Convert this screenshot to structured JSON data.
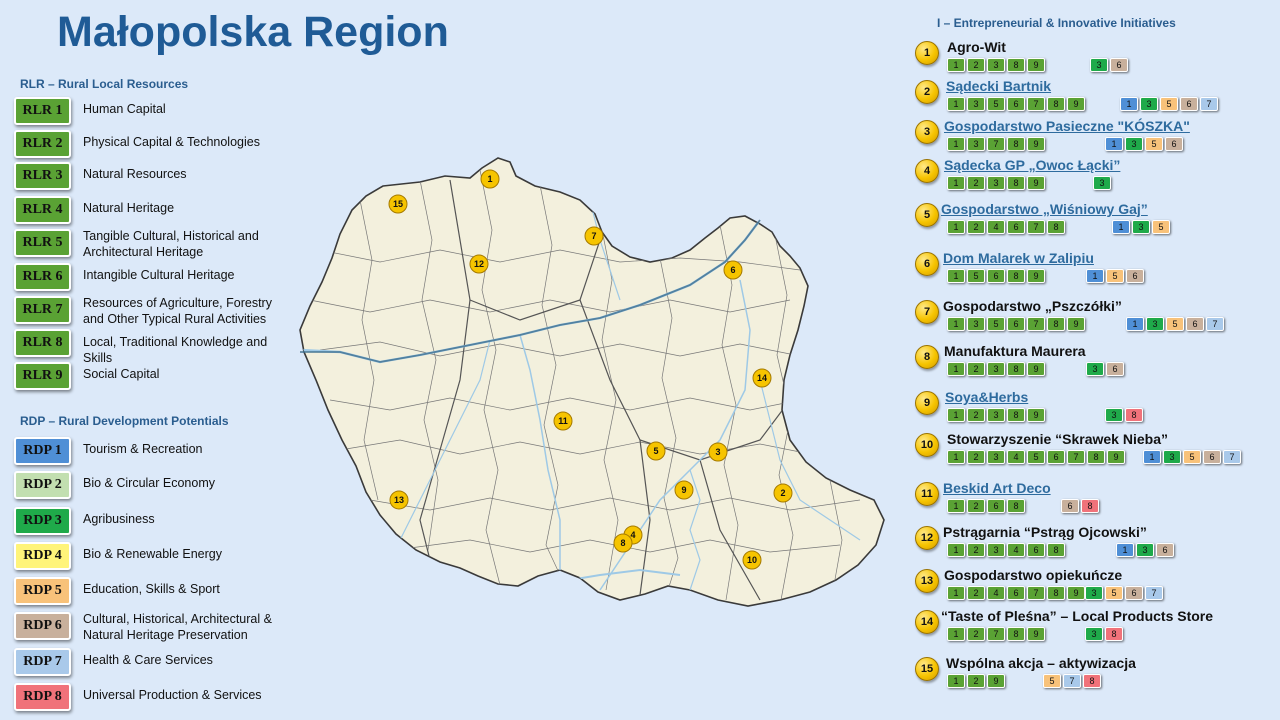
{
  "title": "Małopolska Region",
  "colors": {
    "rlr": "#5aa234",
    "rdp": [
      "#4f8fd6",
      "#c2dfb0",
      "#1faa4a",
      "#fff47a",
      "#f8c27a",
      "#c8b09c",
      "#a9c9ea",
      "#f0727a"
    ],
    "map_fill": "#f3f0dd",
    "river": "#9ec9e6",
    "pin": "#f6c400"
  },
  "rlr": {
    "heading": "RLR – Rural Local Resources",
    "items": [
      {
        "code": "RLR 1",
        "label": "Human Capital"
      },
      {
        "code": "RLR 2",
        "label": "Physical Capital & Technologies"
      },
      {
        "code": "RLR 3",
        "label": "Natural Resources"
      },
      {
        "code": "RLR 4",
        "label": "Natural Heritage"
      },
      {
        "code": "RLR 5",
        "label": "Tangible Cultural, Historical and Architectural Heritage"
      },
      {
        "code": "RLR 6",
        "label": "Intangible Cultural Heritage"
      },
      {
        "code": "RLR 7",
        "label": "Resources of Agriculture, Forestry and Other Typical Rural Activities"
      },
      {
        "code": "RLR 8",
        "label": "Local, Traditional Knowledge and Skills"
      },
      {
        "code": "RLR 9",
        "label": "Social Capital"
      }
    ]
  },
  "rdp": {
    "heading": "RDP – Rural Development Potentials",
    "items": [
      {
        "code": "RDP 1",
        "label": "Tourism & Recreation"
      },
      {
        "code": "RDP 2",
        "label": "Bio & Circular Economy"
      },
      {
        "code": "RDP 3",
        "label": "Agribusiness"
      },
      {
        "code": "RDP 4",
        "label": "Bio & Renewable Energy"
      },
      {
        "code": "RDP 5",
        "label": "Education, Skills & Sport"
      },
      {
        "code": "RDP 6",
        "label": "Cultural, Historical, Architectural & Natural Heritage Preservation"
      },
      {
        "code": "RDP 7",
        "label": "Health & Care Services"
      },
      {
        "code": "RDP 8",
        "label": "Universal Production & Services"
      }
    ]
  },
  "initiatives": {
    "heading": "I – Entrepreneurial & Innovative Initiatives",
    "items": [
      {
        "num": "1",
        "name": "Agro-Wit",
        "link": false,
        "rlr": [
          "1",
          "2",
          "3",
          "8",
          "9"
        ],
        "rdp": [
          "3",
          "6"
        ]
      },
      {
        "num": "2",
        "name": "Sądecki Bartnik",
        "link": true,
        "rlr": [
          "1",
          "3",
          "5",
          "6",
          "7",
          "8",
          "9"
        ],
        "rdp": [
          "1",
          "3",
          "5",
          "6",
          "7"
        ]
      },
      {
        "num": "3",
        "name": "Gospodarstwo Pasieczne \"KÓSZKA\"",
        "link": true,
        "rlr": [
          "1",
          "3",
          "7",
          "8",
          "9"
        ],
        "rdp": [
          "1",
          "3",
          "5",
          "6"
        ]
      },
      {
        "num": "4",
        "name": "Sądecka GP „Owoc Łącki”",
        "link": true,
        "rlr": [
          "1",
          "2",
          "3",
          "8",
          "9"
        ],
        "rdp": [
          "3"
        ]
      },
      {
        "num": "5",
        "name": "Gospodarstwo „Wiśniowy Gaj”",
        "link": true,
        "rlr": [
          "1",
          "2",
          "4",
          "6",
          "7",
          "8"
        ],
        "rdp": [
          "1",
          "3",
          "5"
        ]
      },
      {
        "num": "6",
        "name": "Dom Malarek w Zalipiu",
        "link": true,
        "rlr": [
          "1",
          "5",
          "6",
          "8",
          "9"
        ],
        "rdp": [
          "1",
          "5",
          "6"
        ]
      },
      {
        "num": "7",
        "name": "Gospodarstwo „Pszczółki”",
        "link": false,
        "rlr": [
          "1",
          "3",
          "5",
          "6",
          "7",
          "8",
          "9"
        ],
        "rdp": [
          "1",
          "3",
          "5",
          "6",
          "7"
        ]
      },
      {
        "num": "8",
        "name": "Manufaktura Maurera",
        "link": false,
        "rlr": [
          "1",
          "2",
          "3",
          "8",
          "9"
        ],
        "rdp": [
          "3",
          "6"
        ]
      },
      {
        "num": "9",
        "name": "Soya&Herbs",
        "link": true,
        "rlr": [
          "1",
          "2",
          "3",
          "8",
          "9"
        ],
        "rdp": [
          "3",
          "8"
        ]
      },
      {
        "num": "10",
        "name": "Stowarzyszenie “Skrawek Nieba”",
        "link": false,
        "rlr": [
          "1",
          "2",
          "3",
          "4",
          "5",
          "6",
          "7",
          "8",
          "9"
        ],
        "rdp": [
          "1",
          "3",
          "5",
          "6",
          "7"
        ]
      },
      {
        "num": "11",
        "name": "Beskid Art Deco",
        "link": true,
        "rlr": [
          "1",
          "2",
          "6",
          "8"
        ],
        "rdp": [
          "6",
          "8"
        ]
      },
      {
        "num": "12",
        "name": "Pstrągarnia “Pstrąg Ojcowski”",
        "link": false,
        "rlr": [
          "1",
          "2",
          "3",
          "4",
          "6",
          "8"
        ],
        "rdp": [
          "1",
          "3",
          "6"
        ]
      },
      {
        "num": "13",
        "name": "Gospodarstwo opiekuńcze",
        "link": false,
        "rlr": [
          "1",
          "2",
          "4",
          "6",
          "7",
          "8",
          "9"
        ],
        "rdp": [
          "3",
          "5",
          "6",
          "7"
        ]
      },
      {
        "num": "14",
        "name": "“Taste of Pleśna” – Local Products Store",
        "link": false,
        "rlr": [
          "1",
          "2",
          "7",
          "8",
          "9"
        ],
        "rdp": [
          "3",
          "8"
        ]
      },
      {
        "num": "15",
        "name": "Wspólna akcja – aktywizacja",
        "link": false,
        "rlr": [
          "1",
          "2",
          "9"
        ],
        "rdp": [
          "5",
          "7",
          "8"
        ]
      }
    ]
  },
  "map_pins": [
    "1",
    "2",
    "3",
    "4",
    "5",
    "6",
    "7",
    "8",
    "9",
    "10",
    "11",
    "12",
    "13",
    "14",
    "15"
  ]
}
